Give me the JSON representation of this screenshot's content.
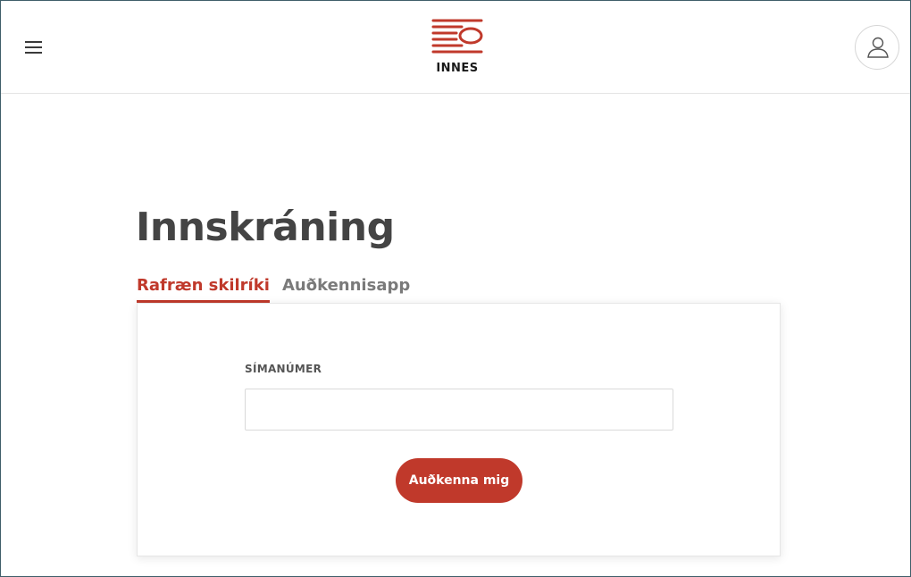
{
  "header": {
    "brand": "INNES",
    "menu_icon": "hamburger-menu-icon",
    "account_icon": "user-icon"
  },
  "main": {
    "title": "Innskráning",
    "tabs": [
      {
        "label": "Rafræn skilríki",
        "active": true
      },
      {
        "label": "Auðkennisapp",
        "active": false
      }
    ],
    "form": {
      "phone_label": "SÍMANÚMER",
      "phone_value": "",
      "submit_label": "Auðkenna mig"
    }
  },
  "colors": {
    "accent": "#c0392b",
    "title_text": "#444444",
    "inactive_tab": "#7a7a7a"
  }
}
